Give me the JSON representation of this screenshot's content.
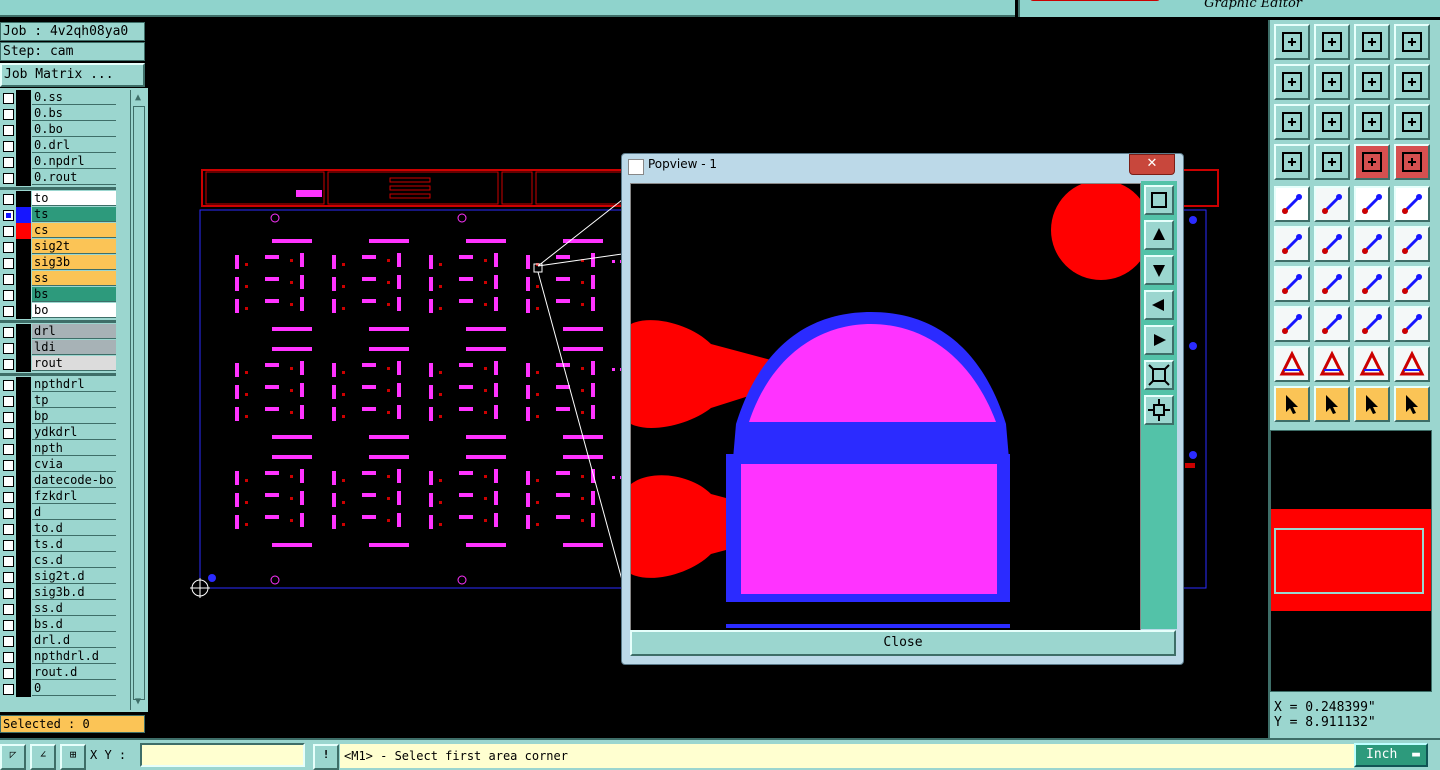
{
  "header": {
    "brand_subtitle": "Graphic Editor"
  },
  "job": {
    "job_label": "Job : 4v2qh08ya0",
    "step_label": "Step: cam",
    "matrix_button": "Job Matrix ..."
  },
  "layers": [
    {
      "name": "0.ss",
      "color": "#9bd6cf"
    },
    {
      "name": "0.bs",
      "color": "#9bd6cf"
    },
    {
      "name": "0.bo",
      "color": "#9bd6cf"
    },
    {
      "name": "0.drl",
      "color": "#9bd6cf"
    },
    {
      "name": "0.npdrl",
      "color": "#9bd6cf"
    },
    {
      "name": "0.rout",
      "color": "#9bd6cf"
    },
    {
      "name": "to",
      "color": "#ffffff"
    },
    {
      "name": "ts",
      "color": "#2d9a7c",
      "swatch": "#1616ff",
      "checked": true
    },
    {
      "name": "cs",
      "color": "#fbc456",
      "swatch": "#ff0000"
    },
    {
      "name": "sig2t",
      "color": "#fbc456"
    },
    {
      "name": "sig3b",
      "color": "#fbc456"
    },
    {
      "name": "ss",
      "color": "#fbc456"
    },
    {
      "name": "bs",
      "color": "#2d9a7c"
    },
    {
      "name": "bo",
      "color": "#ffffff"
    },
    {
      "name": "drl",
      "color": "#a7b2b6"
    },
    {
      "name": "ldi",
      "color": "#a7b2b6"
    },
    {
      "name": "rout",
      "color": "#dcdcdc"
    },
    {
      "name": "npthdrl",
      "color": "#9bd6cf"
    },
    {
      "name": "tp",
      "color": "#9bd6cf"
    },
    {
      "name": "bp",
      "color": "#9bd6cf"
    },
    {
      "name": "ydkdrl",
      "color": "#9bd6cf"
    },
    {
      "name": "npth",
      "color": "#9bd6cf"
    },
    {
      "name": "cvia",
      "color": "#9bd6cf"
    },
    {
      "name": "datecode-bo",
      "color": "#9bd6cf"
    },
    {
      "name": "fzkdrl",
      "color": "#9bd6cf"
    },
    {
      "name": "d",
      "color": "#9bd6cf"
    },
    {
      "name": "to.d",
      "color": "#9bd6cf"
    },
    {
      "name": "ts.d",
      "color": "#9bd6cf"
    },
    {
      "name": "cs.d",
      "color": "#9bd6cf"
    },
    {
      "name": "sig2t.d",
      "color": "#9bd6cf"
    },
    {
      "name": "sig3b.d",
      "color": "#9bd6cf"
    },
    {
      "name": "ss.d",
      "color": "#9bd6cf"
    },
    {
      "name": "bs.d",
      "color": "#9bd6cf"
    },
    {
      "name": "drl.d",
      "color": "#9bd6cf"
    },
    {
      "name": "npthdrl.d",
      "color": "#9bd6cf"
    },
    {
      "name": "rout.d",
      "color": "#9bd6cf"
    },
    {
      "name": "0",
      "color": "#9bd6cf"
    }
  ],
  "selected_label": "Selected : 0",
  "status": {
    "xy_label": "X Y :",
    "message": "<M1> - Select first area corner",
    "unit": "Inch",
    "alert": "!"
  },
  "coords": {
    "x": "X = 0.248399\"",
    "y": "Y = 8.911132\""
  },
  "popup": {
    "title": "Popview - 1",
    "close_label": "Close",
    "x_glyph": "✕"
  },
  "toolbar_icons": [
    "top-icon",
    "down-icon",
    "home-icon",
    "window-icon",
    "left-icon",
    "right-icon",
    "undo-icon",
    "redo-icon",
    "zoom-fit-icon",
    "zoom-icon",
    "ratio-icon",
    "help-icon",
    "wrench-icon",
    "probe-icon",
    "traffic-icon",
    "network-icon",
    "snap-icon",
    "line-icon",
    "ruler-icon",
    "circle-icon",
    "node-icon",
    "cross-icon",
    "point-icon",
    "point2-icon",
    "angle-icon",
    "diag-icon",
    "arc-icon",
    "text-icon",
    "measure-icon",
    "dash-icon",
    "dim-icon",
    "pads-icon",
    "tri1-icon",
    "tri2-icon",
    "tri3-icon",
    "tri4-icon",
    "cursor-icon",
    "cursor2-icon",
    "cursor3-icon",
    "cursor4-icon"
  ]
}
